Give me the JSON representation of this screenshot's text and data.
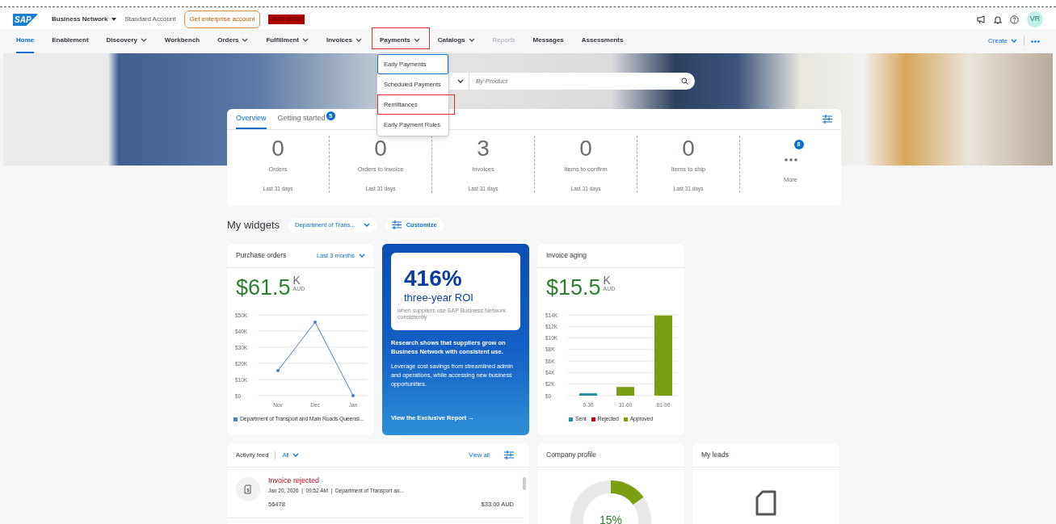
{
  "header": {
    "logo": "SAP",
    "brand": "Business Network",
    "account_type": "Standard Account",
    "upgrade_button": "Get enterprise account",
    "mode_badge": "TEST MODE",
    "avatar": "VR"
  },
  "nav": {
    "items": [
      {
        "label": "Home",
        "dropdown": false,
        "selected": true,
        "disabled": false,
        "annotated": false
      },
      {
        "label": "Enablement",
        "dropdown": false,
        "selected": false,
        "disabled": false,
        "annotated": false
      },
      {
        "label": "Discovery",
        "dropdown": true,
        "selected": false,
        "disabled": false,
        "annotated": false
      },
      {
        "label": "Workbench",
        "dropdown": false,
        "selected": false,
        "disabled": false,
        "annotated": false
      },
      {
        "label": "Orders",
        "dropdown": true,
        "selected": false,
        "disabled": false,
        "annotated": false
      },
      {
        "label": "Fulfillment",
        "dropdown": true,
        "selected": false,
        "disabled": false,
        "annotated": false
      },
      {
        "label": "Invoices",
        "dropdown": true,
        "selected": false,
        "disabled": false,
        "annotated": false
      },
      {
        "label": "Payments",
        "dropdown": true,
        "selected": false,
        "disabled": false,
        "annotated": true
      },
      {
        "label": "Catalogs",
        "dropdown": true,
        "selected": false,
        "disabled": false,
        "annotated": false
      },
      {
        "label": "Reports",
        "dropdown": false,
        "selected": false,
        "disabled": true,
        "annotated": false
      },
      {
        "label": "Messages",
        "dropdown": false,
        "selected": false,
        "disabled": false,
        "annotated": false
      },
      {
        "label": "Assessments",
        "dropdown": false,
        "selected": false,
        "disabled": false,
        "annotated": false
      }
    ],
    "create_button": "Create"
  },
  "payments_menu": [
    {
      "label": "Early Payments",
      "focused": true,
      "annotated": false
    },
    {
      "label": "Scheduled Payments",
      "focused": false,
      "annotated": false
    },
    {
      "label": "Remittances",
      "focused": false,
      "annotated": true
    },
    {
      "label": "Early Payment Rules",
      "focused": false,
      "annotated": false
    }
  ],
  "search": {
    "placeholder": "By Product"
  },
  "overview": {
    "tabs": [
      {
        "label": "Overview",
        "selected": true
      },
      {
        "label": "Getting started",
        "selected": false,
        "badge": "5"
      }
    ],
    "stats": [
      {
        "value": "0",
        "label": "Orders",
        "period": "Last 31 days"
      },
      {
        "value": "0",
        "label": "Orders to invoice",
        "period": "Last 31 days"
      },
      {
        "value": "3",
        "label": "Invoices",
        "period": "Last 31 days"
      },
      {
        "value": "0",
        "label": "Items to confirm",
        "period": "Last 31 days"
      },
      {
        "value": "0",
        "label": "Items to ship",
        "period": "Last 31 days"
      }
    ],
    "more": {
      "label": "More",
      "badge": "8"
    }
  },
  "widgets": {
    "title": "My widgets",
    "filter": "Department of Trans...",
    "customize": "Customize",
    "purchase_orders": {
      "title": "Purchase orders",
      "period": "Last 3 months",
      "amount": "$61.5",
      "unit": "K",
      "currency": "AUD",
      "chart_data": {
        "type": "line",
        "grid": true,
        "legend": "bottom",
        "categories": [
          "Nov",
          "Dec",
          "Jan"
        ],
        "series": [
          {
            "name": "Department of Transport and Main Roads Queensl...",
            "color": "#4a7fc1",
            "values": [
              15500,
              45500,
              0
            ]
          }
        ],
        "ylim": [
          0,
          50000
        ],
        "yticks": [
          {
            "value": 0,
            "label": "$0"
          },
          {
            "value": 10000,
            "label": "$10K"
          },
          {
            "value": 20000,
            "label": "$20K"
          },
          {
            "value": 30000,
            "label": "$30K"
          },
          {
            "value": 40000,
            "label": "$40K"
          },
          {
            "value": 50000,
            "label": "$50K"
          }
        ]
      }
    },
    "promo": {
      "figure": "416%",
      "subtitle": "three-year ROI",
      "note": "when suppliers use SAP Business Network consistently",
      "headline": "Research shows that suppliers grow on Business Network with consistent use.",
      "body": "Leverage cost savings from streamlined admin and operations, while accessing new business opportunities.",
      "link": "View the Exclusive Report →"
    },
    "invoice_aging": {
      "title": "Invoice aging",
      "amount": "$15.5",
      "unit": "K",
      "currency": "AUD",
      "chart_data": {
        "type": "bar",
        "stacked": true,
        "grid": true,
        "legend": "bottom",
        "categories": [
          "0-30",
          "31-60",
          "61-90"
        ],
        "series": [
          {
            "name": "Sent",
            "color": "#1b8f9a",
            "values": [
              400,
              0,
              0
            ]
          },
          {
            "name": "Rejected",
            "color": "#c0001a",
            "values": [
              0,
              0,
              0
            ]
          },
          {
            "name": "Approved",
            "color": "#7a9e10",
            "values": [
              0,
              1500,
              13900
            ]
          }
        ],
        "ylim": [
          0,
          14000
        ],
        "yticks": [
          {
            "value": 0,
            "label": "$0"
          },
          {
            "value": 2000,
            "label": "$2K"
          },
          {
            "value": 4000,
            "label": "$4K"
          },
          {
            "value": 6000,
            "label": "$6K"
          },
          {
            "value": 8000,
            "label": "$8K"
          },
          {
            "value": 10000,
            "label": "$10K"
          },
          {
            "value": 12000,
            "label": "$12K"
          },
          {
            "value": 14000,
            "label": "$14K"
          }
        ]
      }
    },
    "activity_feed": {
      "title": "Activity feed",
      "filter": "All",
      "view_all": "View all",
      "items": [
        {
          "title": "Invoice rejected",
          "meta": "Jan 20, 2026  |  09:52 AM  |  Department of Transport an...",
          "number": "56478",
          "amount": "$33.00 AUD"
        }
      ]
    },
    "company_profile": {
      "title": "Company profile",
      "level": 0.15,
      "percent": "15%"
    },
    "my_leads": {
      "title": "My leads"
    }
  }
}
